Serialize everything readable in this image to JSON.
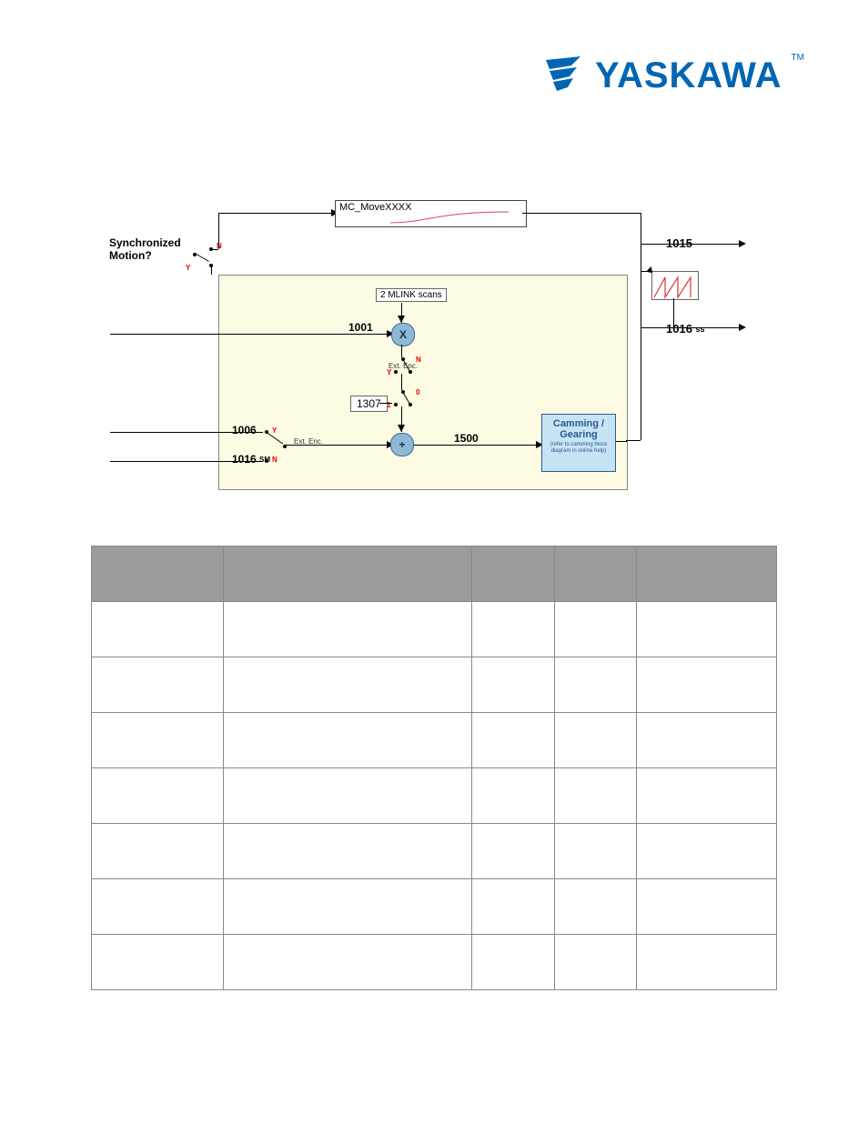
{
  "logo": {
    "text": "YASKAWA",
    "tm": "TM"
  },
  "diagram": {
    "sync_label": "Synchronized\nMotion?",
    "move_box": "MC_MoveXXXX",
    "scan_box": "2 MLINK scans",
    "num_1001": "1001",
    "num_1307": "1307",
    "num_1006": "1006",
    "num_1016": "1016",
    "num_1016_sm": "SM",
    "num_1500": "1500",
    "ext_enc": "Ext. Enc.",
    "camming": "Camming / Gearing",
    "camming_sub": "(refer to camming block diagram in online help)",
    "out_1015": "1015",
    "out_1016": "1016",
    "out_1016_ss": "ss",
    "sw_n": "N",
    "sw_y": "Y",
    "sw_0": "0",
    "sw_1": "1",
    "x": "X",
    "plus": "+"
  },
  "table": {
    "headers": [
      "",
      "",
      "",
      "",
      ""
    ],
    "rows": [
      [
        "",
        "",
        "",
        "",
        ""
      ],
      [
        "",
        "",
        "",
        "",
        ""
      ],
      [
        "",
        "",
        "",
        "",
        ""
      ],
      [
        "",
        "",
        "",
        "",
        ""
      ],
      [
        "",
        "",
        "",
        "",
        ""
      ],
      [
        "",
        "",
        "",
        "",
        ""
      ],
      [
        "",
        "",
        "",
        "",
        ""
      ]
    ]
  }
}
